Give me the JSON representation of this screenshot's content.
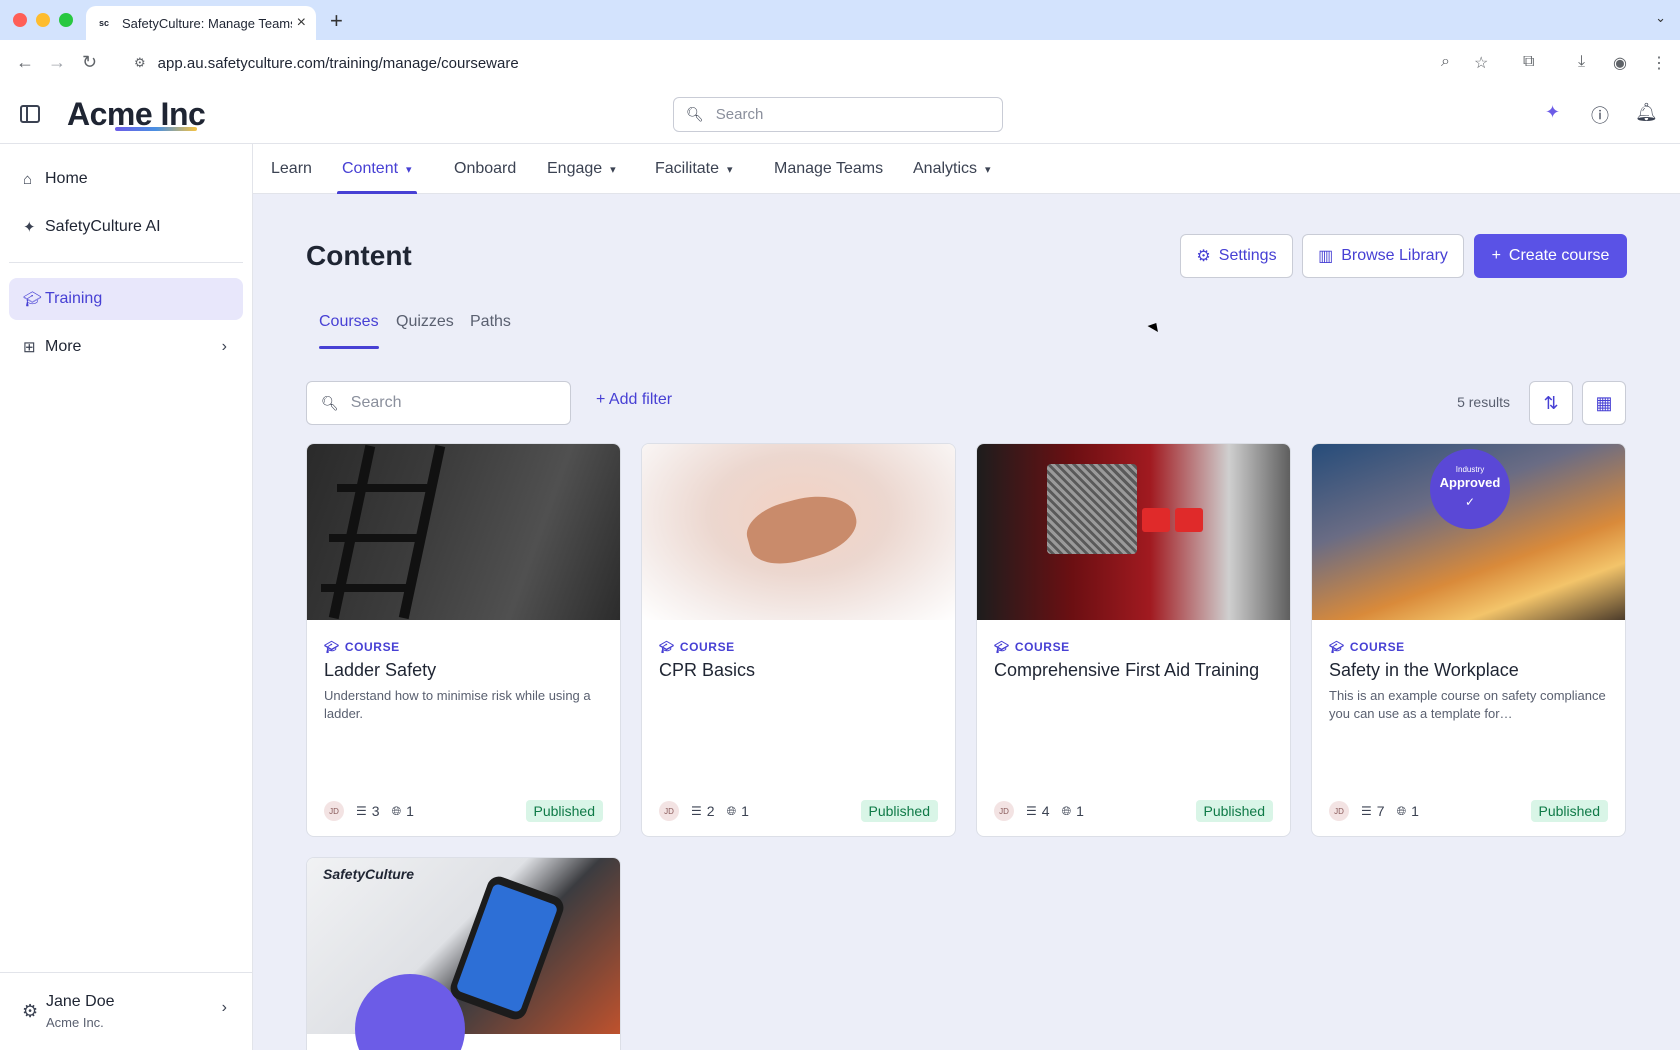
{
  "browser": {
    "tab_title": "SafetyCulture: Manage Teams",
    "favicon_text": "sc",
    "url": "app.au.safetyculture.com/training/manage/courseware"
  },
  "app": {
    "brand": "Acme Inc",
    "search_placeholder": "Search"
  },
  "sidebar": {
    "items": [
      {
        "label": "Home",
        "icon": "home-icon"
      },
      {
        "label": "SafetyCulture AI",
        "icon": "sparkle-icon"
      },
      {
        "label": "Training",
        "icon": "graduation-cap-icon"
      },
      {
        "label": "More",
        "icon": "grid-icon"
      }
    ],
    "user": {
      "name": "Jane Doe",
      "org": "Acme Inc."
    }
  },
  "subnav": {
    "items": [
      {
        "label": "Learn"
      },
      {
        "label": "Content"
      },
      {
        "label": "Onboard"
      },
      {
        "label": "Engage"
      },
      {
        "label": "Facilitate"
      },
      {
        "label": "Manage Teams"
      },
      {
        "label": "Analytics"
      }
    ]
  },
  "main": {
    "title": "Content",
    "settings_label": "Settings",
    "browse_label": "Browse Library",
    "create_label": "Create course",
    "tabs": [
      {
        "label": "Courses"
      },
      {
        "label": "Quizzes"
      },
      {
        "label": "Paths"
      }
    ],
    "search_placeholder": "Search",
    "add_filter_label": "Add filter",
    "results": "5 results"
  },
  "cards": [
    {
      "kind": "COURSE",
      "title": "Ladder Safety",
      "desc": "Understand how to minimise risk while using a ladder.",
      "avatar": "JD",
      "lessons": "3",
      "languages": "1",
      "status": "Published"
    },
    {
      "kind": "COURSE",
      "title": "CPR Basics",
      "desc": "",
      "avatar": "JD",
      "lessons": "2",
      "languages": "1",
      "status": "Published"
    },
    {
      "kind": "COURSE",
      "title": "Comprehensive First Aid Training",
      "desc": "",
      "avatar": "JD",
      "lessons": "4",
      "languages": "1",
      "status": "Published"
    },
    {
      "kind": "COURSE",
      "title": "Safety in the Workplace",
      "desc": "This is an example course on safety compliance you can use as a template for…",
      "avatar": "JD",
      "lessons": "7",
      "languages": "1",
      "status": "Published"
    }
  ],
  "badge": {
    "line1": "Industry",
    "line2": "Approved",
    "line3": "✓"
  },
  "fifth_card_logo": "SafetyCulture",
  "colors": {
    "accent": "#4740d4",
    "primary_button": "#5a52e6",
    "published_bg": "#d9f5e7",
    "published_text": "#0f7a47"
  }
}
